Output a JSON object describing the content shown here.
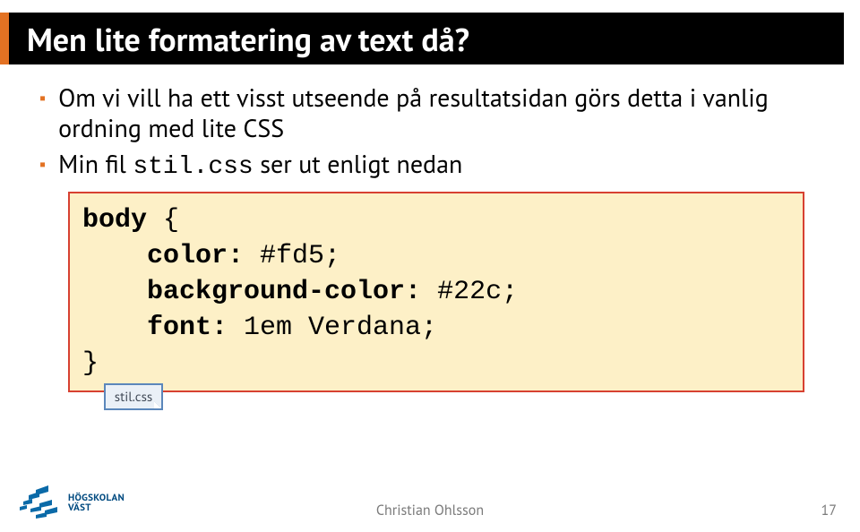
{
  "title": "Men lite formatering av text då?",
  "bullets": [
    {
      "text": "Om vi vill ha ett visst utseende på resultatsidan görs detta i vanlig ordning med lite CSS"
    },
    {
      "text_before": "Min fil ",
      "code_inline": "stil.css",
      "text_after": " ser ut enligt nedan"
    }
  ],
  "code": {
    "line1_selector": "body",
    "line1_brace": " {",
    "line2_prop": "color:",
    "line2_val": " #fd5;",
    "line3_prop": "background-color:",
    "line3_val": " #22c;",
    "line4_prop": "font:",
    "line4_val": " 1em Verdana;",
    "line5_brace": "}"
  },
  "file_tag": "stil.css",
  "footer": {
    "author": "Christian Ohlsson",
    "page": "17"
  },
  "logo": {
    "line1": "HÖGSKOLAN",
    "line2": "VÄST"
  }
}
